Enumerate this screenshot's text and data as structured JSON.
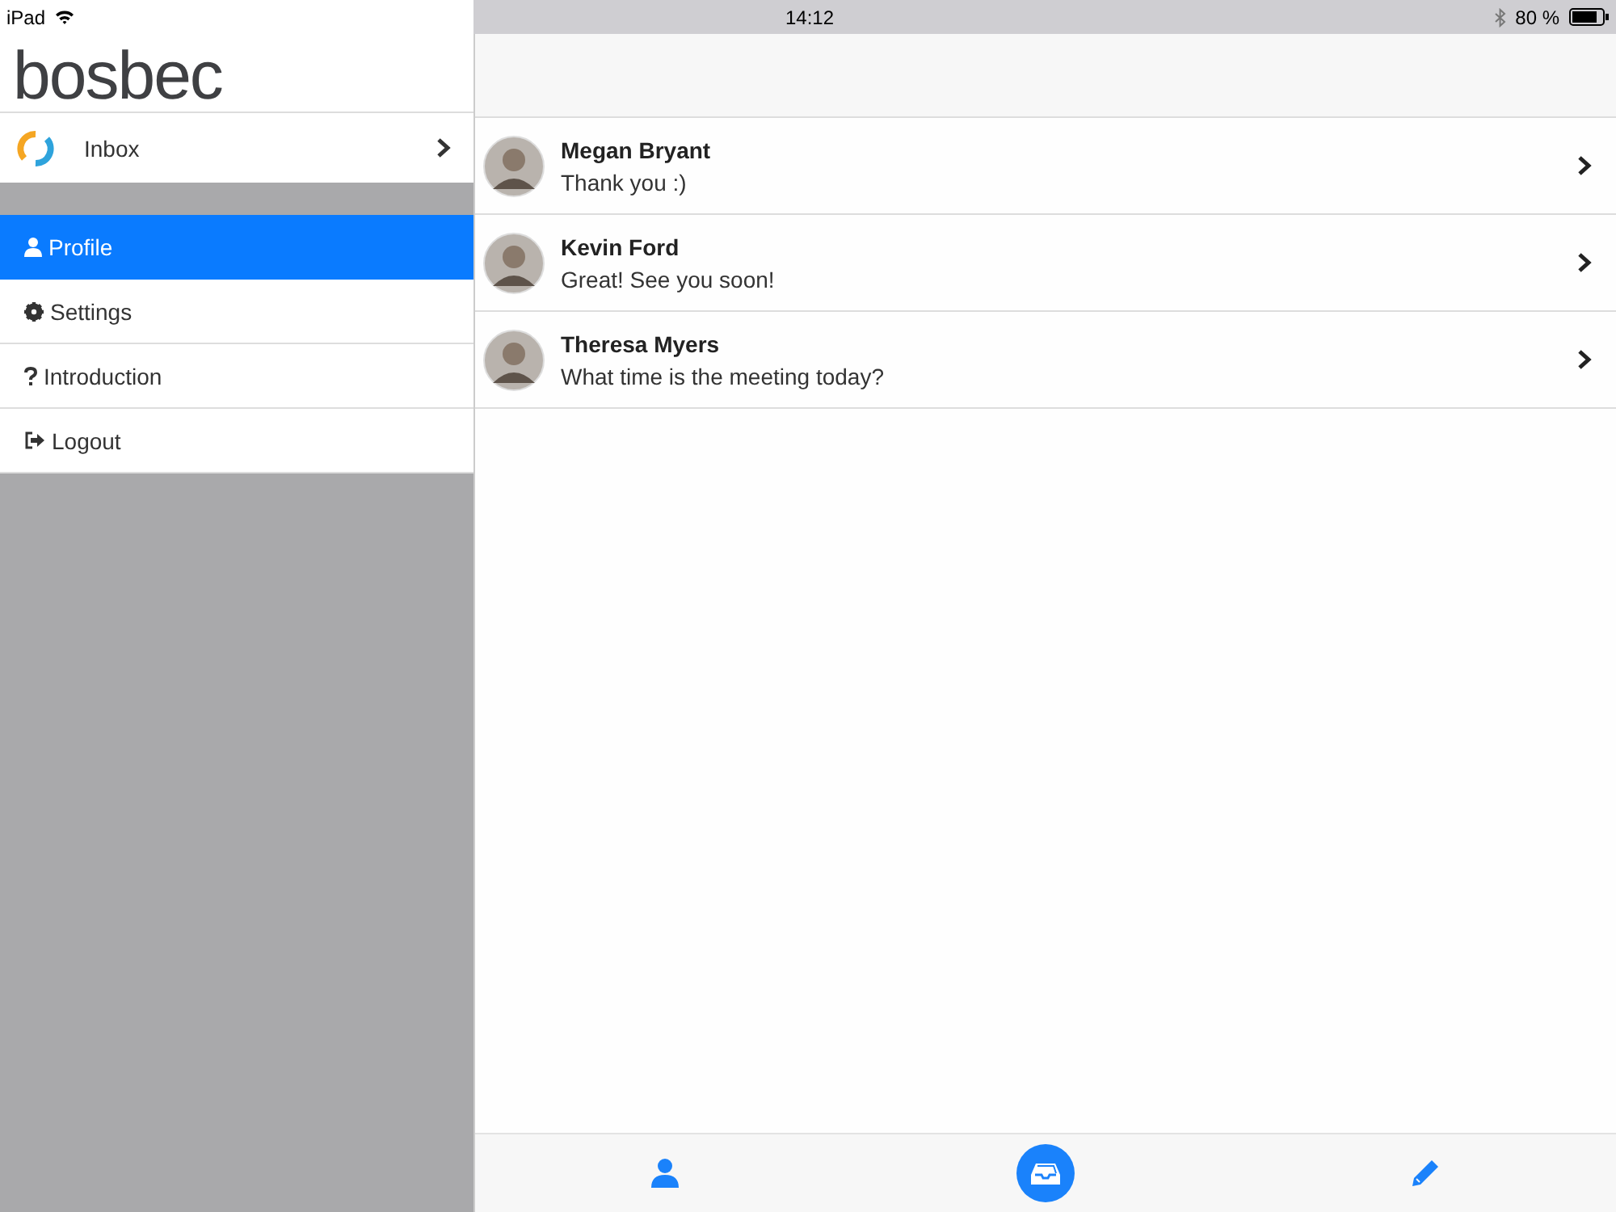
{
  "status_bar": {
    "device": "iPad",
    "time": "14:12",
    "battery": "80 %"
  },
  "sidebar": {
    "logo": "bosbec",
    "inbox": {
      "label": "Inbox"
    },
    "items": [
      {
        "label": "Profile",
        "kind": "user",
        "selected": true
      },
      {
        "label": "Settings",
        "kind": "gear",
        "selected": false
      },
      {
        "label": "Introduction",
        "kind": "question",
        "selected": false
      },
      {
        "label": "Logout",
        "kind": "logout",
        "selected": false
      }
    ]
  },
  "conversations": [
    {
      "name": "Megan Bryant",
      "message": "Thank you :)"
    },
    {
      "name": "Kevin Ford",
      "message": "Great! See you soon!"
    },
    {
      "name": "Theresa Myers",
      "message": "What time is the meeting today?"
    }
  ],
  "tab_bar": [
    {
      "kind": "user",
      "selected": false
    },
    {
      "kind": "inbox",
      "selected": true
    },
    {
      "kind": "pencil",
      "selected": false
    }
  ]
}
